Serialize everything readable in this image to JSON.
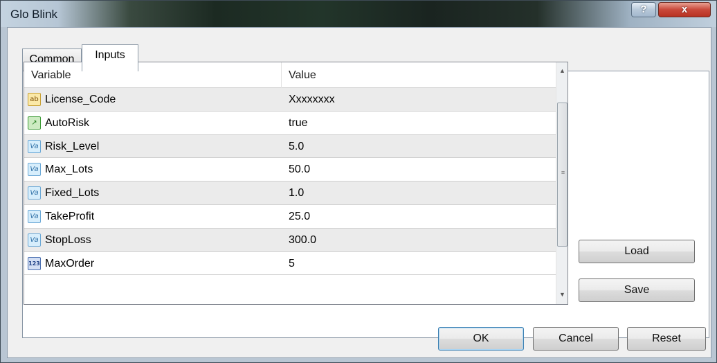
{
  "window": {
    "title": "Glo Blink",
    "help_label": "?",
    "close_label": "x"
  },
  "tabs": [
    {
      "label": "Common",
      "active": false
    },
    {
      "label": "Inputs",
      "active": true
    }
  ],
  "grid": {
    "columns": [
      "Variable",
      "Value"
    ],
    "rows": [
      {
        "icon": "string-icon",
        "glyph": "ab",
        "name": "License_Code",
        "value": "Xxxxxxxx"
      },
      {
        "icon": "bool-icon",
        "glyph": "↗",
        "name": "AutoRisk",
        "value": "true"
      },
      {
        "icon": "double-icon",
        "glyph": "Va",
        "name": "Risk_Level",
        "value": "5.0"
      },
      {
        "icon": "double-icon",
        "glyph": "Va",
        "name": "Max_Lots",
        "value": "50.0"
      },
      {
        "icon": "double-icon",
        "glyph": "Va",
        "name": "Fixed_Lots",
        "value": "1.0"
      },
      {
        "icon": "double-icon",
        "glyph": "Va",
        "name": "TakeProfit",
        "value": "25.0"
      },
      {
        "icon": "double-icon",
        "glyph": "Va",
        "name": "StopLoss",
        "value": "300.0"
      },
      {
        "icon": "integer-icon",
        "glyph": "123",
        "name": "MaxOrder",
        "value": "5"
      }
    ]
  },
  "buttons": {
    "load": "Load",
    "save": "Save",
    "ok": "OK",
    "cancel": "Cancel",
    "reset": "Reset"
  },
  "scrollbar": {
    "up_glyph": "▲",
    "down_glyph": "▼",
    "grip_glyph": "≡"
  }
}
